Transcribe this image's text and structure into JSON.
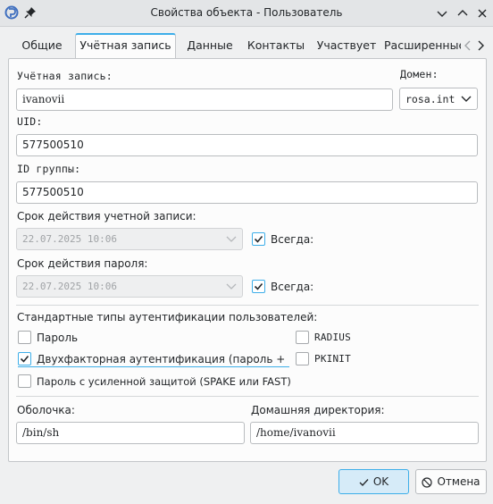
{
  "window": {
    "title": "Свойства объекта - Пользователь"
  },
  "tabs": [
    {
      "label": "Общие",
      "active": false
    },
    {
      "label": "Учётная запись",
      "active": true
    },
    {
      "label": "Данные",
      "active": false
    },
    {
      "label": "Контакты",
      "active": false
    },
    {
      "label": "Участвует",
      "active": false
    },
    {
      "label": "Расширенные",
      "active": false
    }
  ],
  "account": {
    "account_label": "Учётная запись:",
    "account_value": "ivanovii",
    "domain_label": "Домен:",
    "domain_value": "rosa.int",
    "uid_label": "UID:",
    "uid_value": "577500510",
    "gid_label": "ID группы:",
    "gid_value": "577500510",
    "account_expiry_label": "Срок действия учетной записи:",
    "account_expiry_value": "22.07.2025 10:06",
    "account_always_label": "Всегда:",
    "account_always_checked": true,
    "password_expiry_label": "Срок действия пароля:",
    "password_expiry_value": "22.07.2025 10:06",
    "password_always_label": "Всегда:",
    "password_always_checked": true
  },
  "auth": {
    "section_label": "Стандартные типы аутентификации пользователей:",
    "options": [
      {
        "label": "Пароль",
        "checked": false
      },
      {
        "label": "RADIUS",
        "checked": false
      },
      {
        "label": "Двухфакторная аутентификация (пароль + (",
        "checked": true
      },
      {
        "label": "PKINIT",
        "checked": false
      },
      {
        "label": "Пароль с усиленной защитой (SPAKE или FAST)",
        "checked": false
      }
    ]
  },
  "shell": {
    "label": "Оболочка:",
    "value": "/bin/sh"
  },
  "home": {
    "label": "Домашняя директория:",
    "value": "/home/ivanovii"
  },
  "buttons": {
    "ok": "OK",
    "cancel": "Отмена"
  },
  "colors": {
    "accent": "#3daee9",
    "window_bg": "#eff0f1",
    "panel_bg": "#fcfcfc"
  }
}
